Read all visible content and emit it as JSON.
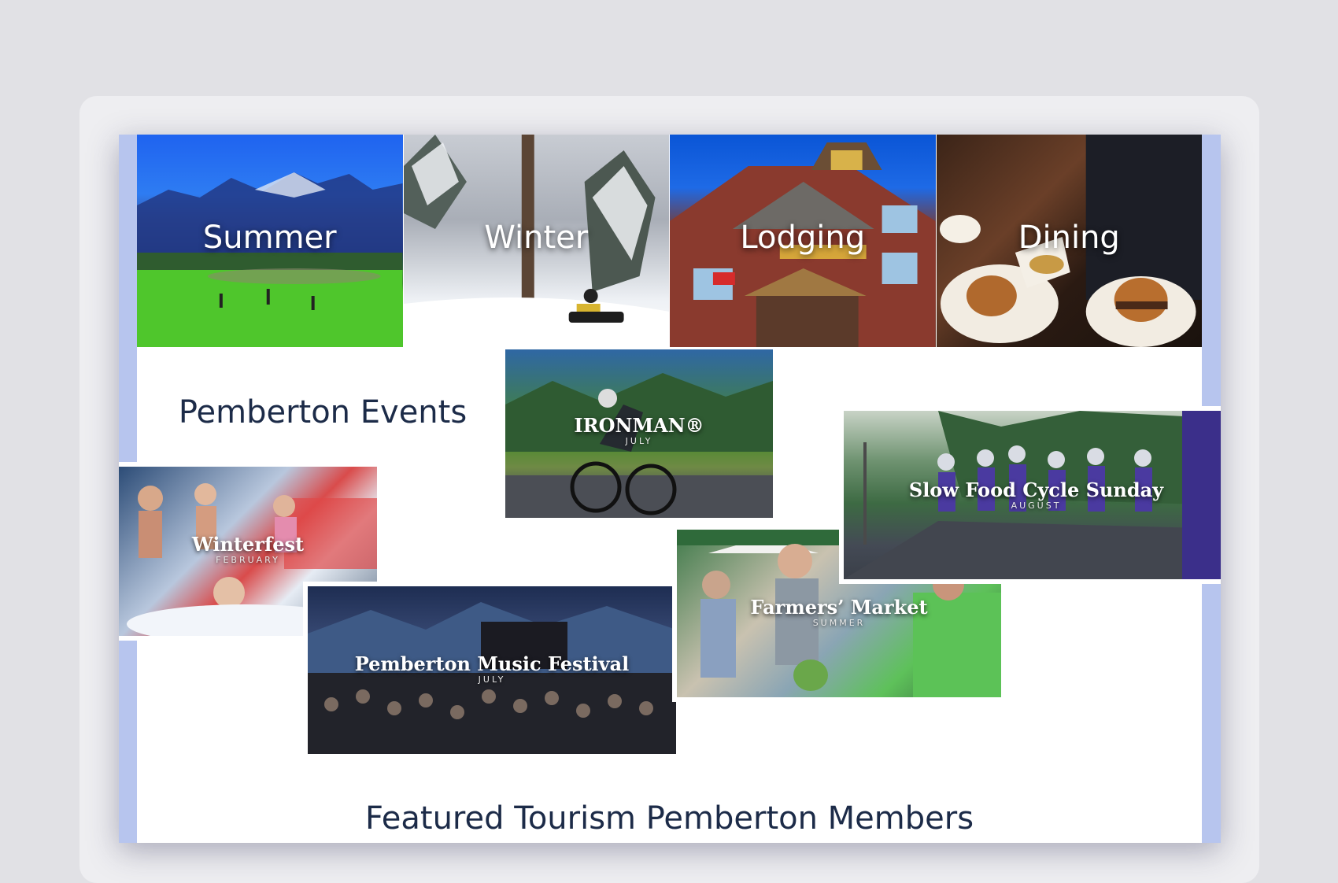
{
  "categories": [
    {
      "label": "Summer",
      "icon": "golf-course-photo"
    },
    {
      "label": "Winter",
      "icon": "snowmobile-photo"
    },
    {
      "label": "Lodging",
      "icon": "lodge-photo"
    },
    {
      "label": "Dining",
      "icon": "burger-photo"
    }
  ],
  "events": {
    "heading": "Pemberton Events",
    "ironman": {
      "title": "IRONMAN®",
      "when": "JULY"
    },
    "winterfest": {
      "title": "Winterfest",
      "when": "FEBRUARY"
    },
    "music": {
      "title": "Pemberton Music Festival",
      "when": "JULY"
    },
    "market": {
      "title": "Farmers’ Market",
      "when": "SUMMER"
    },
    "cycle": {
      "title": "Slow Food Cycle Sunday",
      "when": "AUGUST"
    }
  },
  "featured": {
    "heading": "Featured Tourism Pemberton Members"
  },
  "colors": {
    "heading": "#1c2b48",
    "side_band": "#b7c5ee",
    "background": "#e1e1e5"
  }
}
